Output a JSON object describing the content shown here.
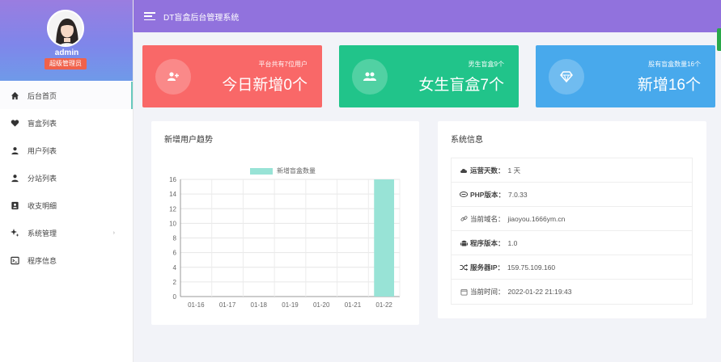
{
  "header": {
    "title": "DT盲盒后台管理系统"
  },
  "profile": {
    "username": "admin",
    "role": "超级管理员"
  },
  "sidebar": {
    "items": [
      {
        "label": "后台首页",
        "icon": "home-icon"
      },
      {
        "label": "盲盒列表",
        "icon": "heart-icon"
      },
      {
        "label": "用户列表",
        "icon": "user-icon"
      },
      {
        "label": "分站列表",
        "icon": "user-icon"
      },
      {
        "label": "收支明细",
        "icon": "contact-card-icon"
      },
      {
        "label": "系统管理",
        "icon": "magic-icon"
      },
      {
        "label": "程序信息",
        "icon": "terminal-icon"
      }
    ]
  },
  "stats": [
    {
      "small": "平台共有7位用户",
      "big": "今日新增0个",
      "color": "#f96868",
      "icon": "user-add-icon"
    },
    {
      "small": "男生盲盒9个",
      "big": "女生盲盒7个",
      "color": "#21c48a",
      "icon": "users-icon"
    },
    {
      "small": "股有盲盒数量16个",
      "big": "新增16个",
      "color": "#48a9ec",
      "icon": "diamond-icon"
    }
  ],
  "trend_panel": {
    "title": "新增用户趋势"
  },
  "system_panel": {
    "title": "系统信息",
    "rows": [
      {
        "label": "运营天数：",
        "value": "1 天",
        "icon": "cloud-icon"
      },
      {
        "label": "PHP版本：",
        "value": "7.0.33",
        "icon": "php-icon"
      },
      {
        "label": "当前域名：",
        "value": "jiaoyou.1666ym.cn",
        "icon": "link-icon"
      },
      {
        "label": "程序版本：",
        "value": "1.0",
        "icon": "android-icon"
      },
      {
        "label": "服务器IP：",
        "value": "159.75.109.160",
        "icon": "shuffle-icon"
      },
      {
        "label": "当前时间：",
        "value": "2022-01-22 21:19:43",
        "icon": "clock-icon"
      }
    ]
  },
  "chart_data": {
    "type": "bar",
    "categories": [
      "01-16",
      "01-17",
      "01-18",
      "01-19",
      "01-20",
      "01-21",
      "01-22"
    ],
    "series": [
      {
        "name": "新增盲盒数量",
        "values": [
          0,
          0,
          0,
          0,
          0,
          0,
          16
        ],
        "color": "#98e3d6"
      }
    ],
    "ylim": [
      0,
      16
    ],
    "yticks": [
      "0",
      "2",
      "4",
      "6",
      "8",
      "10",
      "12",
      "14",
      "16"
    ],
    "grid": true,
    "legend": "top"
  }
}
